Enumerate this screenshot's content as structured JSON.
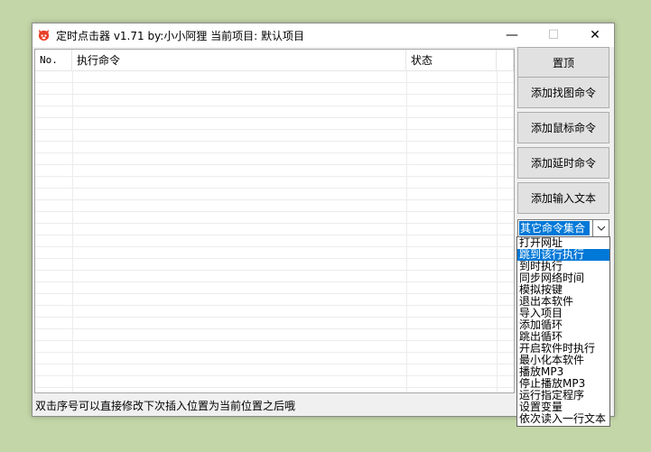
{
  "window": {
    "title": "定时点击器 v1.71  by:小小阿狸   当前项目: 默认项目",
    "controls": {
      "minimize": "—",
      "maximize": "☐",
      "close": "✕"
    }
  },
  "listview": {
    "columns": [
      "No.",
      "执行命令",
      "状态",
      ""
    ]
  },
  "buttons": {
    "top": "置顶",
    "add_find_image": "添加找图命令",
    "add_mouse": "添加鼠标命令",
    "add_delay": "添加延时命令",
    "add_input_text": "添加输入文本"
  },
  "combo": {
    "value": "其它命令集合",
    "options": [
      "打开网址",
      "跳到该行执行",
      "到时执行",
      "同步网络时间",
      "模拟按键",
      "退出本软件",
      "导入项目",
      "添加循环",
      "跳出循环",
      "开启软件时执行",
      "最小化本软件",
      "播放MP3",
      "停止播放MP3",
      "运行指定程序",
      "设置变量",
      "依次读入一行文本"
    ],
    "selected_index": 1
  },
  "statusbar": {
    "text": "双击序号可以直接修改下次插入位置为当前位置之后哦"
  },
  "colors": {
    "background": "#c3d6a8",
    "selection": "#0078d7",
    "window": "#f0f0f0"
  }
}
